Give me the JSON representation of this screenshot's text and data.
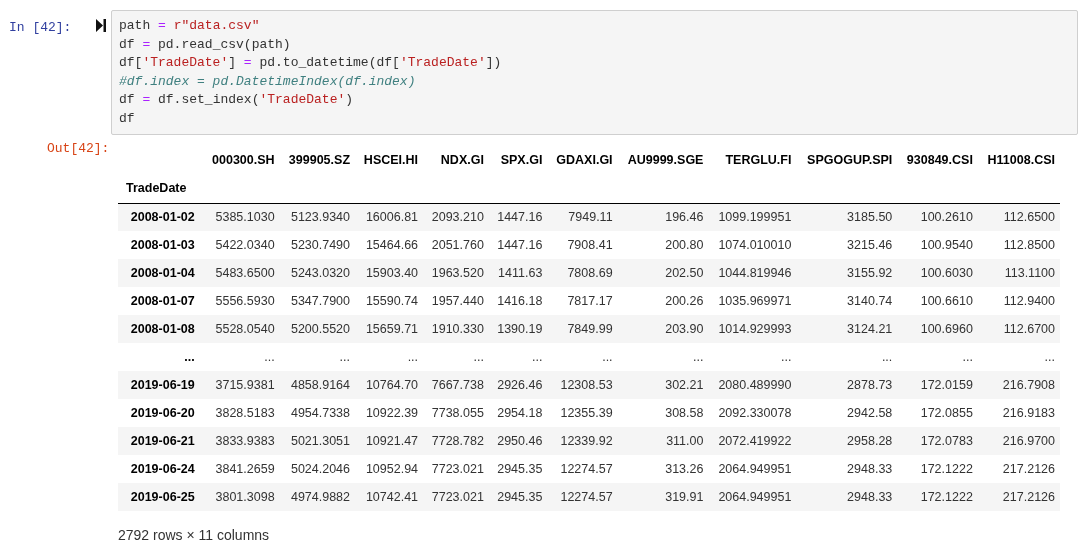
{
  "input_cell": {
    "prompt": "In [42]:",
    "lines": [
      [
        {
          "kind": "plain",
          "text": "path "
        },
        {
          "kind": "op",
          "text": "= "
        },
        {
          "kind": "str",
          "text": "r\"data.csv\""
        }
      ],
      [
        {
          "kind": "plain",
          "text": "df "
        },
        {
          "kind": "op",
          "text": "="
        },
        {
          "kind": "plain",
          "text": " pd.read_csv(path)"
        }
      ],
      [
        {
          "kind": "plain",
          "text": "df["
        },
        {
          "kind": "str",
          "text": "'TradeDate'"
        },
        {
          "kind": "plain",
          "text": "] "
        },
        {
          "kind": "op",
          "text": "="
        },
        {
          "kind": "plain",
          "text": " pd.to_datetime(df["
        },
        {
          "kind": "str",
          "text": "'TradeDate'"
        },
        {
          "kind": "plain",
          "text": "])"
        }
      ],
      [
        {
          "kind": "comment",
          "text": "#df.index = pd.DatetimeIndex(df.index)"
        }
      ],
      [
        {
          "kind": "plain",
          "text": "df "
        },
        {
          "kind": "op",
          "text": "="
        },
        {
          "kind": "plain",
          "text": " df.set_index("
        },
        {
          "kind": "str",
          "text": "'TradeDate'"
        },
        {
          "kind": "plain",
          "text": ")"
        }
      ],
      [
        {
          "kind": "plain",
          "text": "df"
        }
      ]
    ]
  },
  "output_cell": {
    "prompt": "Out[42]:",
    "table": {
      "index_name": "TradeDate",
      "columns": [
        "000300.SH",
        "399905.SZ",
        "HSCEI.HI",
        "NDX.GI",
        "SPX.GI",
        "GDAXI.GI",
        "AU9999.SGE",
        "TERGLU.FI",
        "SPGOGUP.SPI",
        "930849.CSI",
        "H11008.CSI"
      ],
      "rows": [
        {
          "index": "2008-01-02",
          "cells": [
            "5385.1030",
            "5123.9340",
            "16006.81",
            "2093.210",
            "1447.16",
            "7949.11",
            "196.46",
            "1099.199951",
            "3185.50",
            "100.2610",
            "112.6500"
          ]
        },
        {
          "index": "2008-01-03",
          "cells": [
            "5422.0340",
            "5230.7490",
            "15464.66",
            "2051.760",
            "1447.16",
            "7908.41",
            "200.80",
            "1074.010010",
            "3215.46",
            "100.9540",
            "112.8500"
          ]
        },
        {
          "index": "2008-01-04",
          "cells": [
            "5483.6500",
            "5243.0320",
            "15903.40",
            "1963.520",
            "1411.63",
            "7808.69",
            "202.50",
            "1044.819946",
            "3155.92",
            "100.6030",
            "113.1100"
          ]
        },
        {
          "index": "2008-01-07",
          "cells": [
            "5556.5930",
            "5347.7900",
            "15590.74",
            "1957.440",
            "1416.18",
            "7817.17",
            "200.26",
            "1035.969971",
            "3140.74",
            "100.6610",
            "112.9400"
          ]
        },
        {
          "index": "2008-01-08",
          "cells": [
            "5528.0540",
            "5200.5520",
            "15659.71",
            "1910.330",
            "1390.19",
            "7849.99",
            "203.90",
            "1014.929993",
            "3124.21",
            "100.6960",
            "112.6700"
          ]
        },
        {
          "index": "...",
          "cells": [
            "...",
            "...",
            "...",
            "...",
            "...",
            "...",
            "...",
            "...",
            "...",
            "...",
            "..."
          ]
        },
        {
          "index": "2019-06-19",
          "cells": [
            "3715.9381",
            "4858.9164",
            "10764.70",
            "7667.738",
            "2926.46",
            "12308.53",
            "302.21",
            "2080.489990",
            "2878.73",
            "172.0159",
            "216.7908"
          ]
        },
        {
          "index": "2019-06-20",
          "cells": [
            "3828.5183",
            "4954.7338",
            "10922.39",
            "7738.055",
            "2954.18",
            "12355.39",
            "308.58",
            "2092.330078",
            "2942.58",
            "172.0855",
            "216.9183"
          ]
        },
        {
          "index": "2019-06-21",
          "cells": [
            "3833.9383",
            "5021.3051",
            "10921.47",
            "7728.782",
            "2950.46",
            "12339.92",
            "311.00",
            "2072.419922",
            "2958.28",
            "172.0783",
            "216.9700"
          ]
        },
        {
          "index": "2019-06-24",
          "cells": [
            "3841.2659",
            "5024.2046",
            "10952.94",
            "7723.021",
            "2945.35",
            "12274.57",
            "313.26",
            "2064.949951",
            "2948.33",
            "172.1222",
            "217.2126"
          ]
        },
        {
          "index": "2019-06-25",
          "cells": [
            "3801.3098",
            "4974.9882",
            "10742.41",
            "7723.021",
            "2945.35",
            "12274.57",
            "319.91",
            "2064.949951",
            "2948.33",
            "172.1222",
            "217.2126"
          ]
        }
      ]
    },
    "shape": "2792 rows × 11 columns"
  }
}
